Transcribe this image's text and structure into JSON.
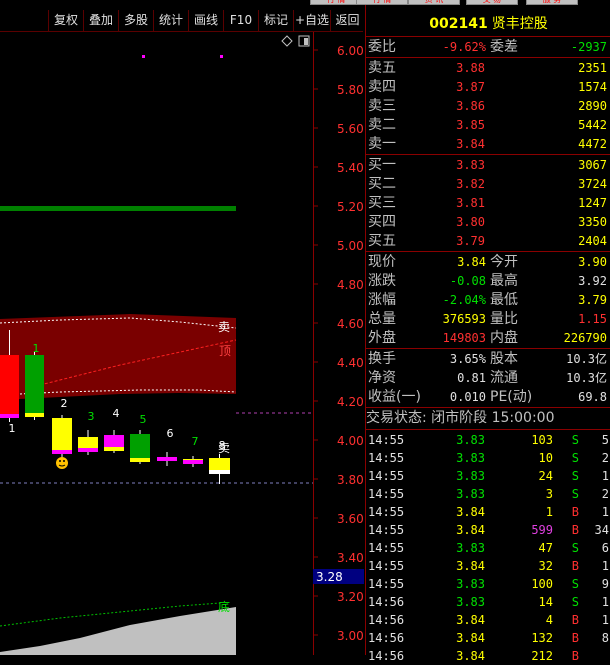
{
  "toolbar": {
    "buttons": [
      "复权",
      "叠加",
      "多股",
      "统计",
      "画线",
      "F10",
      "标记",
      "+自选",
      "返回"
    ],
    "top_clips": [
      "行 情",
      "资 讯",
      "交 易",
      "服 务"
    ]
  },
  "chart": {
    "price_ticks": [
      "6.00",
      "5.80",
      "5.60",
      "5.40",
      "5.20",
      "5.00",
      "4.80",
      "4.60",
      "4.40",
      "4.20",
      "4.00",
      "3.80",
      "3.60",
      "3.40",
      "3.20",
      "3.00"
    ],
    "current_price_label": "3.28",
    "candle_labels": [
      "1",
      "1",
      "2",
      "3",
      "4",
      "5",
      "6",
      "7",
      "8"
    ],
    "annotations": {
      "sell": "卖",
      "top": "顶",
      "sell2": "卖",
      "bottom": "底"
    },
    "colors": {
      "up": "#ff0000",
      "down": "#00a000",
      "band": "#7a0000",
      "green_line": "#008000",
      "magenta": "#ff00ff",
      "yellow": "#ffff00"
    }
  },
  "quote": {
    "code": "002141",
    "name": "贤丰控股",
    "weibi": {
      "label": "委比",
      "value": "-9.62%",
      "diff_label": "委差",
      "diff": "-2937"
    },
    "asks": [
      {
        "label": "卖五",
        "price": "3.88",
        "vol": "2351"
      },
      {
        "label": "卖四",
        "price": "3.87",
        "vol": "1574"
      },
      {
        "label": "卖三",
        "price": "3.86",
        "vol": "2890"
      },
      {
        "label": "卖二",
        "price": "3.85",
        "vol": "5442"
      },
      {
        "label": "卖一",
        "price": "3.84",
        "vol": "4472"
      }
    ],
    "bids": [
      {
        "label": "买一",
        "price": "3.83",
        "vol": "3067"
      },
      {
        "label": "买二",
        "price": "3.82",
        "vol": "3724"
      },
      {
        "label": "买三",
        "price": "3.81",
        "vol": "1247"
      },
      {
        "label": "买四",
        "price": "3.80",
        "vol": "3350"
      },
      {
        "label": "买五",
        "price": "3.79",
        "vol": "2404"
      }
    ],
    "stats": [
      {
        "l1": "现价",
        "v1": "3.84",
        "l2": "今开",
        "v2": "3.90"
      },
      {
        "l1": "涨跌",
        "v1": "-0.08",
        "l2": "最高",
        "v2": "3.92"
      },
      {
        "l1": "涨幅",
        "v1": "-2.04%",
        "l2": "最低",
        "v2": "3.79"
      },
      {
        "l1": "总量",
        "v1": "376593",
        "l2": "量比",
        "v2": "1.15"
      },
      {
        "l1": "外盘",
        "v1": "149803",
        "l2": "内盘",
        "v2": "226790"
      }
    ],
    "fund": [
      {
        "l1": "换手",
        "v1": "3.65%",
        "l2": "股本",
        "v2": "10.3亿"
      },
      {
        "l1": "净资",
        "v1": "0.81",
        "l2": "流通",
        "v2": "10.3亿"
      },
      {
        "l1": "收益(一)",
        "v1": "0.010",
        "l2": "PE(动)",
        "v2": "69.8"
      }
    ],
    "trade_status": "交易状态: 闭市阶段 15:00:00",
    "ticks": [
      {
        "time": "14:55",
        "price": "3.83",
        "vol": "103",
        "side": "S",
        "n": "5"
      },
      {
        "time": "14:55",
        "price": "3.83",
        "vol": "10",
        "side": "S",
        "n": "2"
      },
      {
        "time": "14:55",
        "price": "3.83",
        "vol": "24",
        "side": "S",
        "n": "1"
      },
      {
        "time": "14:55",
        "price": "3.83",
        "vol": "3",
        "side": "S",
        "n": "2"
      },
      {
        "time": "14:55",
        "price": "3.84",
        "vol": "1",
        "side": "B",
        "n": "1"
      },
      {
        "time": "14:55",
        "price": "3.84",
        "vol": "599",
        "side": "B",
        "n": "34"
      },
      {
        "time": "14:55",
        "price": "3.83",
        "vol": "47",
        "side": "S",
        "n": "6"
      },
      {
        "time": "14:55",
        "price": "3.84",
        "vol": "32",
        "side": "B",
        "n": "1"
      },
      {
        "time": "14:55",
        "price": "3.83",
        "vol": "100",
        "side": "S",
        "n": "9"
      },
      {
        "time": "14:56",
        "price": "3.83",
        "vol": "14",
        "side": "S",
        "n": "1"
      },
      {
        "time": "14:56",
        "price": "3.84",
        "vol": "4",
        "side": "B",
        "n": "1"
      },
      {
        "time": "14:56",
        "price": "3.84",
        "vol": "132",
        "side": "B",
        "n": "8"
      },
      {
        "time": "14:56",
        "price": "3.84",
        "vol": "212",
        "side": "B",
        "n": ""
      }
    ]
  }
}
